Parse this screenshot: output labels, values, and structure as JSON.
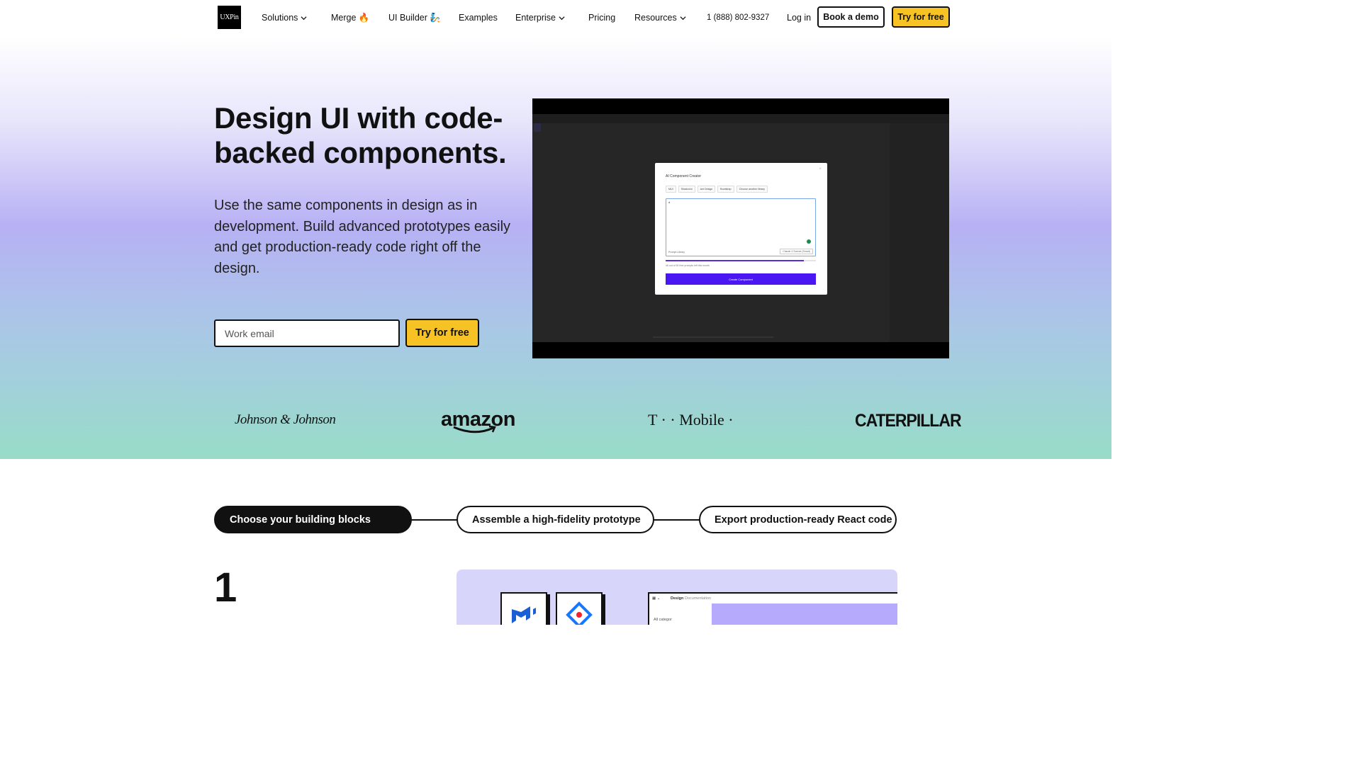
{
  "header": {
    "logo_text": "UXPin",
    "nav": {
      "solutions": "Solutions",
      "merge": "Merge 🔥",
      "ui_builder": "UI Builder 🧞",
      "examples": "Examples",
      "enterprise": "Enterprise",
      "pricing": "Pricing",
      "resources": "Resources",
      "phone": "1 (888) 802-9327",
      "login": "Log in"
    },
    "book_demo": "Book a demo",
    "try_free": "Try for free"
  },
  "hero": {
    "title": "Design UI with code-backed components.",
    "subtitle": "Use the same components in design as in development. Build advanced prototypes easily and get production-ready code right off the design.",
    "email_placeholder": "Work email",
    "cta": "Try for free"
  },
  "video": {
    "modal_title": "AI Component Creator",
    "tabs": [
      "MUI",
      "Shadcn/ui",
      "Ant Design",
      "Bootstrap",
      "Choose another library"
    ],
    "prompt_text": "d",
    "prompt_library": "Prompt Library",
    "model": "Claude 4 Sonnet (Smart)",
    "limit_text": "46 out of 50 free prompts left this month",
    "prompts_used_fraction": 0.92,
    "create_button": "Create Component"
  },
  "logos": [
    "Johnson & Johnson",
    "amazon",
    "T · · Mobile ·",
    "CATERPILLAR"
  ],
  "steps": [
    {
      "label": "Choose your building blocks",
      "active": true
    },
    {
      "label": "Assemble a high-fidelity prototype",
      "active": false
    },
    {
      "label": "Export production-ready React code",
      "active": false
    }
  ],
  "section": {
    "number": "1",
    "app_tabs": [
      "Design",
      "Documentation"
    ],
    "filter_label": "All categor"
  },
  "colors": {
    "accent_yellow": "#f7c324",
    "primary_purple": "#4a17f2",
    "text_dark": "#111111"
  }
}
